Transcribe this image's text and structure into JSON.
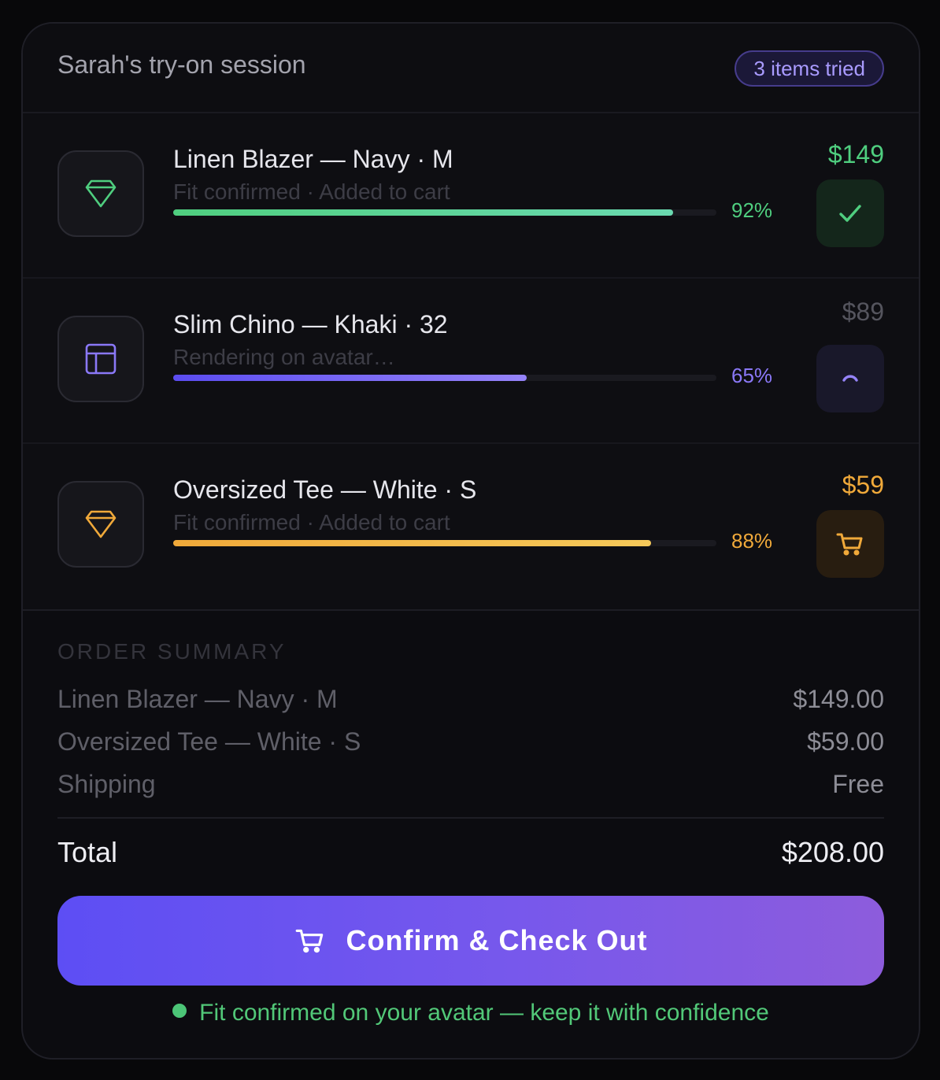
{
  "session": {
    "title": "Sarah's try-on session",
    "badge": "3 items tried"
  },
  "items": [
    {
      "name": "Linen Blazer — Navy · M",
      "status": "Fit confirmed · Added to cart",
      "price": "$149",
      "fit_percent": 92,
      "fit_label": "92%",
      "state": "confirmed",
      "thumb_icon": "diamond-icon",
      "action_icon": "check-icon",
      "accent": "#4fce7f"
    },
    {
      "name": "Slim Chino — Khaki · 32",
      "status": "Rendering on avatar…",
      "price": "$89",
      "fit_percent": 65,
      "fit_label": "65%",
      "state": "rendering",
      "thumb_icon": "layout-icon",
      "action_icon": "spinner-icon",
      "accent": "#7d6af5"
    },
    {
      "name": "Oversized Tee — White · S",
      "status": "Fit confirmed · Added to cart",
      "price": "$59",
      "fit_percent": 88,
      "fit_label": "88%",
      "state": "in-cart",
      "thumb_icon": "diamond-icon",
      "action_icon": "cart-icon",
      "accent": "#f0a93a"
    }
  ],
  "summary": {
    "label": "ORDER SUMMARY",
    "lines": [
      {
        "label": "Linen Blazer — Navy · M",
        "value": "$149.00"
      },
      {
        "label": "Oversized Tee — White · S",
        "value": "$59.00"
      },
      {
        "label": "Shipping",
        "value": "Free"
      }
    ],
    "total_label": "Total",
    "total_value": "$208.00"
  },
  "checkout": {
    "label": "Confirm & Check Out",
    "icon": "cart-icon"
  },
  "footnote": "Fit confirmed on your avatar — keep it with confidence"
}
